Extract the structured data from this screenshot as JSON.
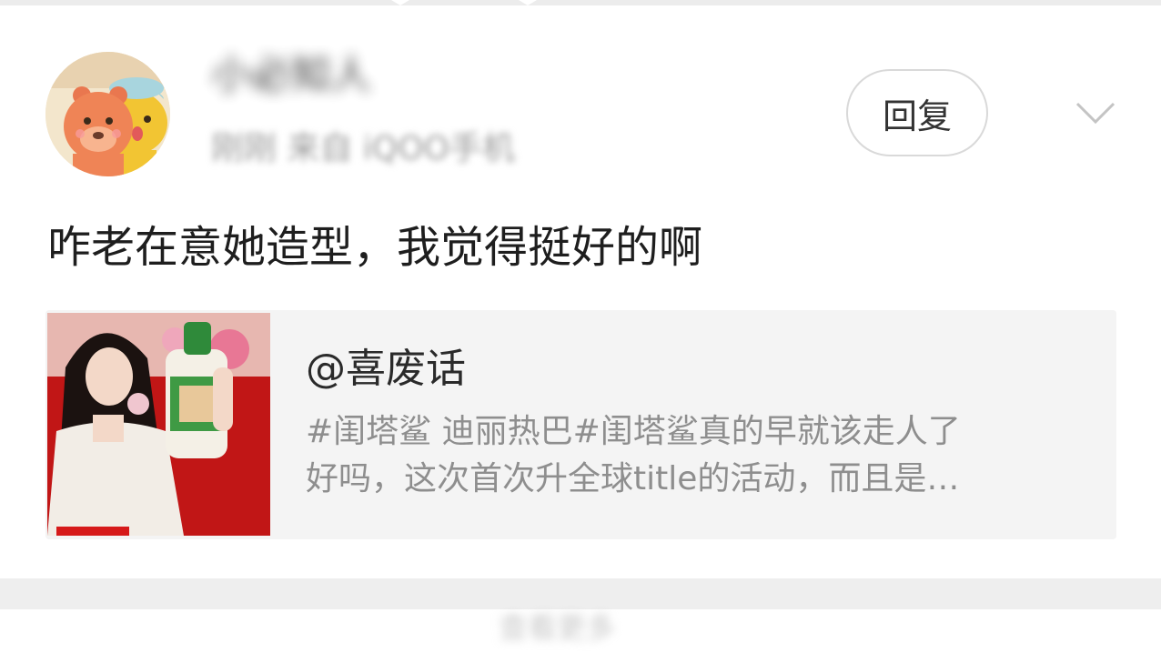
{
  "top_bar": {},
  "comment": {
    "username": "小必知人",
    "meta": "刚刚 来自 iQOO手机",
    "reply_label": "回复",
    "expand_icon": "chevron-down-icon",
    "text": "咋老在意她造型，我觉得挺好的啊"
  },
  "quoted_post": {
    "author": "@喜废话",
    "excerpt_line1": "#闺塔鲨 迪丽热巴#闺塔鲨真的早就该走人了",
    "excerpt_line2": "好吗，这次首次升全球title的活动，而且是…",
    "thumbnail": "product-photo"
  },
  "footer": {
    "hint": "查看更多"
  },
  "colors": {
    "background": "#ffffff",
    "card_background": "#f4f4f4",
    "text_primary": "#1e1e1e",
    "text_secondary": "#8e8e8e",
    "thumbnail_red": "#b50d0d"
  }
}
